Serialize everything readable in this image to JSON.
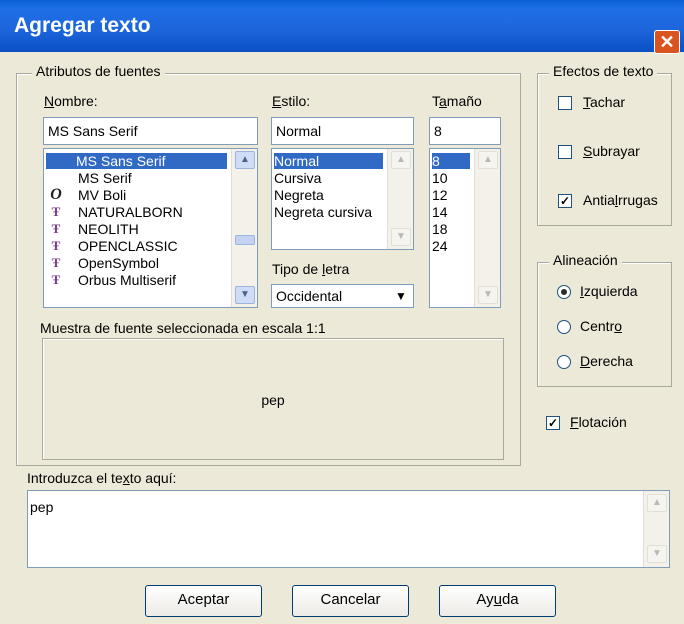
{
  "window": {
    "title": "Agregar texto",
    "close_glyph": "✕"
  },
  "font_attributes": {
    "legend": "Atributos de fuentes",
    "name": {
      "label_pre": "",
      "label_acc": "N",
      "label_post": "ombre:",
      "value": "MS Sans Serif",
      "options": [
        {
          "text": "MS Sans Serif",
          "icon": ""
        },
        {
          "text": "MS Serif",
          "icon": ""
        },
        {
          "text": "MV Boli",
          "icon": "opentype-icon"
        },
        {
          "text": "NATURALBORN",
          "icon": "truetype-icon"
        },
        {
          "text": "NEOLITH",
          "icon": "truetype-icon"
        },
        {
          "text": "OPENCLASSIC",
          "icon": "truetype-icon"
        },
        {
          "text": "OpenSymbol",
          "icon": "truetype-icon"
        },
        {
          "text": "Orbus Multiserif",
          "icon": "truetype-icon"
        }
      ],
      "selected_index": 0
    },
    "style": {
      "label_pre": "",
      "label_acc": "E",
      "label_post": "stilo:",
      "value": "Normal",
      "options": [
        "Normal",
        "Cursiva",
        "Negreta",
        "Negreta cursiva"
      ],
      "selected_index": 0
    },
    "size": {
      "label_pre": "T",
      "label_acc": "a",
      "label_post": "maño",
      "value": "8",
      "options": [
        "8",
        "10",
        "12",
        "14",
        "18",
        "24"
      ],
      "selected_index": 0
    },
    "script": {
      "label_pre": "Tipo de ",
      "label_acc": "l",
      "label_post": "etra",
      "value": "Occidental"
    },
    "sample": {
      "label": "Muestra de fuente seleccionada en escala 1:1",
      "text": "pep"
    }
  },
  "text_effects": {
    "legend": "Efectos de texto",
    "strike": {
      "acc": "T",
      "rest": "achar",
      "checked": false
    },
    "underline": {
      "acc": "S",
      "rest": "ubrayar",
      "checked": false
    },
    "antialias": {
      "pre": "Antia",
      "acc": "l",
      "rest": "rrugas",
      "checked": true
    }
  },
  "alignment": {
    "legend": "Alineación",
    "left": {
      "acc": "I",
      "rest": "zquierda",
      "selected": true
    },
    "center": {
      "pre": "Centr",
      "acc": "o",
      "rest": "",
      "selected": false
    },
    "right": {
      "acc": "D",
      "rest": "erecha",
      "selected": false
    }
  },
  "floating": {
    "acc": "F",
    "rest": "lotación",
    "checked": true
  },
  "input": {
    "label_pre": "Introduzca el te",
    "label_acc": "x",
    "label_post": "to aquí:",
    "value": "pep"
  },
  "buttons": {
    "ok": "Aceptar",
    "cancel": "Cancelar",
    "help_pre": "Ay",
    "help_acc": "u",
    "help_post": "da"
  },
  "glyphs": {
    "check": "✓",
    "up": "▲",
    "down": "▼",
    "truetype": "Ŧ",
    "opentype": "O"
  },
  "colors": {
    "title_bar": "#1f6fe6",
    "selection": "#316ac5",
    "dialog_bg": "#ece9d8",
    "close_button": "#d9541e"
  }
}
